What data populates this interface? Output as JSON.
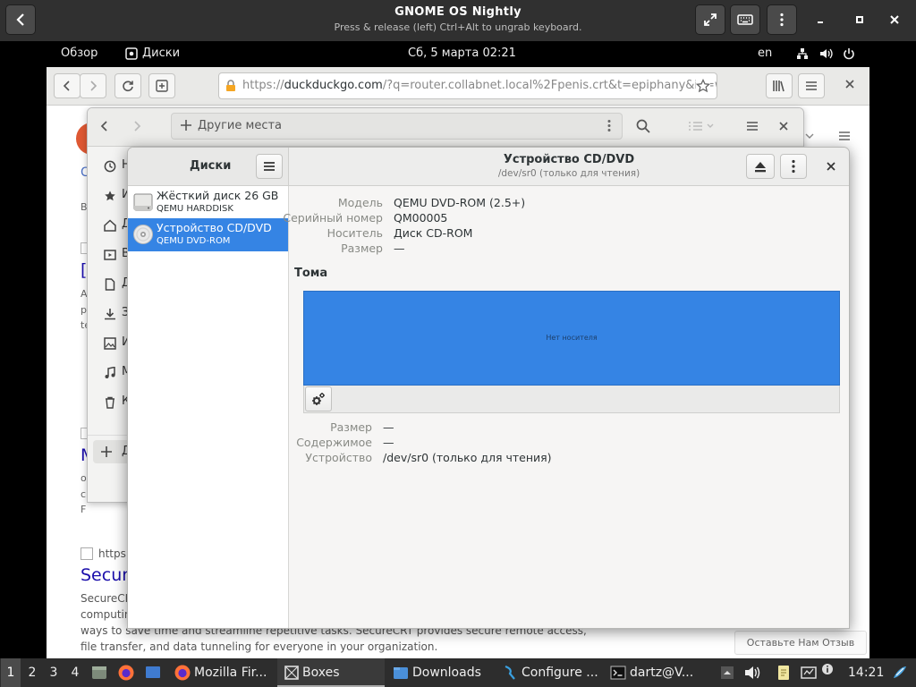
{
  "boxes": {
    "title": "GNOME OS Nightly",
    "subtitle": "Press & release (left) Ctrl+Alt to ungrab keyboard."
  },
  "gnome_topbar": {
    "overview": "Обзор",
    "app_name": "Диски",
    "clock": "Сб, 5 марта  02:21",
    "keyboard_layout": "en"
  },
  "browser": {
    "url_prefix": "https://",
    "url_host": "duckduckgo.com",
    "url_rest": "/?q=router.collabnet.local%2Fpenis.crt&t=epiphany&ia=web",
    "results": {
      "r1_url": "https:",
      "r1_title": "Secure",
      "r1_snippet_1": "SecureCR",
      "r1_snippet_2": "computin",
      "r1_snippet_3": "ways to save time and streamline repetitive tasks. SecureCRT provides secure remote access,",
      "r1_snippet_4": "file transfer, and data tunneling for everyone in your organization.",
      "feedback": "Оставьте Нам Отзыв",
      "frag_title_1": "[V",
      "frag_title_2": "M",
      "frag_line_a": "A",
      "frag_line_b": "p",
      "frag_line_c": "te",
      "frag_line_d": "o",
      "frag_line_e": "c",
      "frag_line_f": "F",
      "frag_tab": "C",
      "frag_label": "B"
    }
  },
  "files": {
    "path_label": "Другие места",
    "sidebar_items": [
      "Н",
      "И",
      "Д",
      "В",
      "Д",
      "З",
      "И",
      "М",
      "К"
    ],
    "add_other": "Д"
  },
  "disks": {
    "left_title": "Диски",
    "title": "Устройство CD/DVD",
    "subtitle": "/dev/sr0 (только для чтения)",
    "drives": [
      {
        "name": "Жёсткий диск 26 GB",
        "model": "QEMU HARDDISK"
      },
      {
        "name": "Устройство CD/DVD",
        "model": "QEMU DVD-ROM"
      }
    ],
    "info": {
      "model_label": "Модель",
      "model_value": "QEMU DVD-ROM (2.5+)",
      "serial_label": "Серийный номер",
      "serial_value": "QM00005",
      "media_label": "Носитель",
      "media_value": "Диск CD-ROM",
      "size_label": "Размер",
      "size_value": "—"
    },
    "volumes_title": "Тома",
    "volume_bar_label": "Нет носителя",
    "volume_info": {
      "size_label": "Размер",
      "size_value": "—",
      "contents_label": "Содержимое",
      "contents_value": "—",
      "device_label": "Устройство",
      "device_value": "/dev/sr0 (только для чтения)"
    }
  },
  "taskbar": {
    "workspaces": [
      "1",
      "2",
      "3",
      "4"
    ],
    "tasks": [
      {
        "label": "Mozilla Fir..."
      },
      {
        "label": "Boxes"
      },
      {
        "label": "Downloads"
      },
      {
        "label": "Configure ..."
      },
      {
        "label": "dartz@V..."
      }
    ],
    "clock": "14:21"
  },
  "colors": {
    "accent": "#3584e4",
    "header_dark": "#303030",
    "taskbar": "#2d2d2d"
  }
}
